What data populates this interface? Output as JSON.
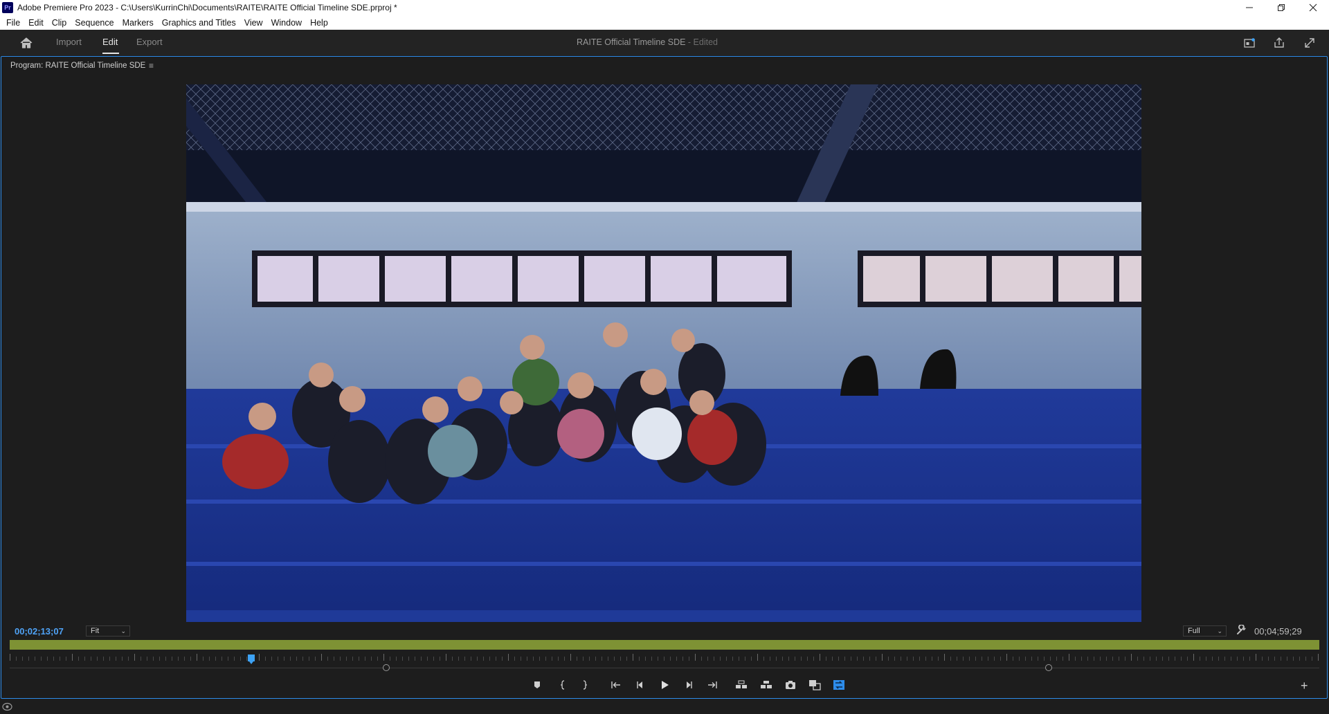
{
  "window": {
    "title": "Adobe Premiere Pro 2023 - C:\\Users\\KurrinChi\\Documents\\RAITE\\RAITE Official Timeline SDE.prproj *",
    "logo_text": "Pr",
    "controls": [
      "minimize-icon",
      "restore-icon",
      "close-icon"
    ]
  },
  "menu": [
    "File",
    "Edit",
    "Clip",
    "Sequence",
    "Markers",
    "Graphics and Titles",
    "View",
    "Window",
    "Help"
  ],
  "header": {
    "tabs": [
      "Import",
      "Edit",
      "Export"
    ],
    "active_tab": "Edit",
    "sequence_title": "RAITE Official Timeline SDE",
    "edited_suffix": " - Edited",
    "icons": [
      "home-icon",
      "workspaces-icon",
      "share-icon",
      "fullscreen-icon"
    ]
  },
  "panel": {
    "tab_label": "Program: RAITE Official Timeline SDE",
    "menu_glyph": "≡",
    "timecode_current": "00;02;13;07",
    "zoom_select": "Fit",
    "resolution_select": "Full",
    "timecode_duration": "00;04;59;29",
    "playhead_fraction": 0.1842,
    "transport_icons": [
      "add-marker-icon",
      "mark-in-icon",
      "mark-out-icon",
      "go-to-in-icon",
      "step-back-icon",
      "play-icon",
      "step-forward-icon",
      "go-to-out-icon",
      "lift-icon",
      "extract-icon",
      "export-frame-icon",
      "comparison-view-icon",
      "proxy-toggle-icon",
      "button-editor-icon"
    ],
    "add_glyph": "+"
  },
  "colors": {
    "accent": "#2d8ceb",
    "timecode": "#4fa3f7",
    "work_area": "#7e9234",
    "background": "#1d1d1d"
  }
}
